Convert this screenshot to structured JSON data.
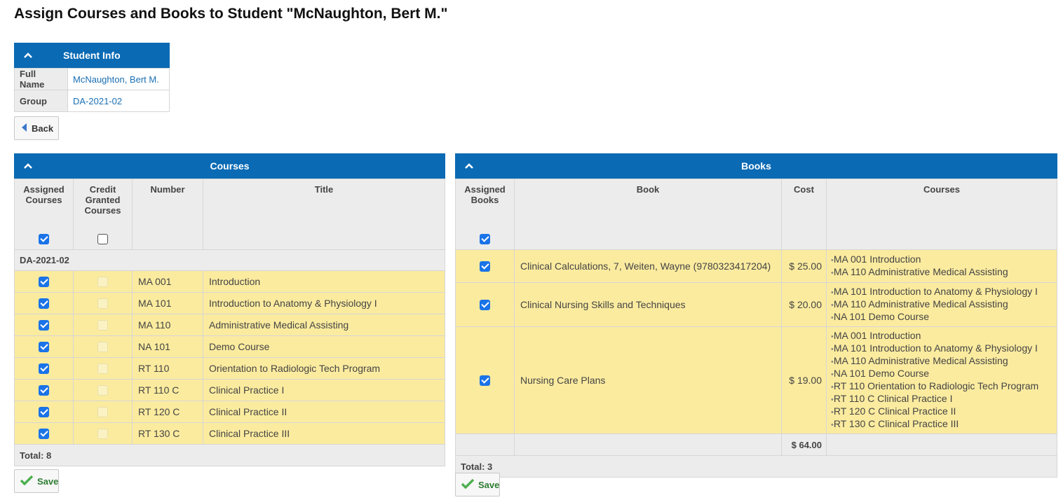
{
  "page": {
    "title": "Assign Courses and Books to Student \"McNaughton, Bert M.\""
  },
  "student_info": {
    "header": "Student Info",
    "rows": [
      {
        "label": "Full Name",
        "value": "McNaughton, Bert M."
      },
      {
        "label": "Group",
        "value": "DA-2021-02"
      }
    ]
  },
  "back_button": {
    "label": "Back"
  },
  "courses": {
    "header": "Courses",
    "columns": {
      "assigned": "Assigned Courses",
      "credit": "Credit Granted Courses",
      "number": "Number",
      "title": "Title"
    },
    "header_assigned_checked": true,
    "header_credit_checked": false,
    "group": "DA-2021-02",
    "rows": [
      {
        "number": "MA 001",
        "title": "Introduction",
        "assigned": true
      },
      {
        "number": "MA 101",
        "title": "Introduction to Anatomy & Physiology I",
        "assigned": true
      },
      {
        "number": "MA 110",
        "title": "Administrative Medical Assisting",
        "assigned": true
      },
      {
        "number": "NA 101",
        "title": "Demo Course",
        "assigned": true
      },
      {
        "number": "RT 110",
        "title": "Orientation to Radiologic Tech Program",
        "assigned": true
      },
      {
        "number": "RT 110 C",
        "title": "Clinical Practice I",
        "assigned": true
      },
      {
        "number": "RT 120 C",
        "title": "Clinical Practice II",
        "assigned": true
      },
      {
        "number": "RT 130 C",
        "title": "Clinical Practice III",
        "assigned": true
      }
    ],
    "total": "Total: 8",
    "save_label": "Save"
  },
  "books": {
    "header": "Books",
    "columns": {
      "assigned": "Assigned Books",
      "book": "Book",
      "cost": "Cost",
      "courses": "Courses"
    },
    "header_assigned_checked": true,
    "rows": [
      {
        "book": "Clinical Calculations, 7, Weiten, Wayne (9780323417204)",
        "cost": "$ 25.00",
        "assigned": true,
        "courses": [
          "MA 001 Introduction",
          "MA 110 Administrative Medical Assisting"
        ]
      },
      {
        "book": "Clinical Nursing Skills and Techniques",
        "cost": "$ 20.00",
        "assigned": true,
        "courses": [
          "MA 101 Introduction to Anatomy & Physiology I",
          "MA 110 Administrative Medical Assisting",
          "NA 101 Demo Course"
        ]
      },
      {
        "book": "Nursing Care Plans",
        "cost": "$ 19.00",
        "assigned": true,
        "courses": [
          "MA 001 Introduction",
          "MA 101 Introduction to Anatomy & Physiology I",
          "MA 110 Administrative Medical Assisting",
          "NA 101 Demo Course",
          "RT 110 Orientation to Radiologic Tech Program",
          "RT 110 C Clinical Practice I",
          "RT 120 C Clinical Practice II",
          "RT 130 C Clinical Practice III"
        ]
      }
    ],
    "cost_total": "$ 64.00",
    "total": "Total: 3",
    "save_label": "Save"
  },
  "colors": {
    "header_blue": "#0a6ab4",
    "row_yellow": "#fbeb9f",
    "link_blue": "#1a6fb3",
    "save_green": "#2e7d32"
  }
}
